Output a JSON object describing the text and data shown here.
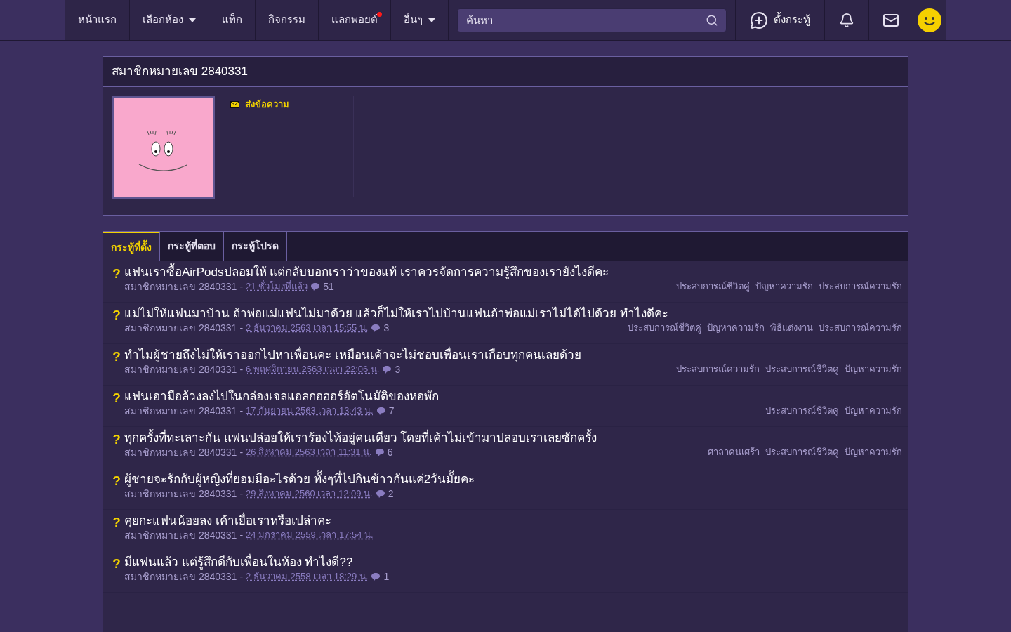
{
  "nav": {
    "items": [
      {
        "label": "หน้าแรก",
        "dropdown": false,
        "notification": false
      },
      {
        "label": "เลือกห้อง",
        "dropdown": true,
        "notification": false
      },
      {
        "label": "แท็ก",
        "dropdown": false,
        "notification": false
      },
      {
        "label": "กิจกรรม",
        "dropdown": false,
        "notification": false
      },
      {
        "label": "แลกพอยต์",
        "dropdown": false,
        "notification": true
      },
      {
        "label": "อื่นๆ",
        "dropdown": true,
        "notification": false
      }
    ],
    "search": {
      "placeholder": "ค้นหา"
    },
    "new_topic": "ตั้งกระทู้"
  },
  "profile": {
    "title": "สมาชิกหมายเลข 2840331",
    "send_message": "ส่งข้อความ"
  },
  "tabs": [
    {
      "label": "กระทู้ที่ตั้ง",
      "selected": true
    },
    {
      "label": "กระทู้ที่ตอบ",
      "selected": false
    },
    {
      "label": "กระทู้โปรด",
      "selected": false
    }
  ],
  "status_mark": "?",
  "separator": "-",
  "posts": [
    {
      "title": "แฟนเราซื้อAirPodsปลอมให้ แต่กลับบอกเราว่าของแท้ เราควรจัดการความรู้สึกของเรายังไงดีคะ",
      "author": "สมาชิกหมายเลข 2840331",
      "time": "21 ชั่วโมงที่แล้ว",
      "comments": "51",
      "tags": [
        "ประสบการณ์ชีวิตคู่",
        "ปัญหาความรัก",
        "ประสบการณ์ความรัก"
      ]
    },
    {
      "title": "แม่ไม่ให้แฟนมาบ้าน ถ้าพ่อแม่แฟนไม่มาด้วย แล้วก็ไม่ให้เราไปบ้านแฟนถ้าพ่อแม่เราไม่ได้ไปด้วย ทำไงดีคะ",
      "author": "สมาชิกหมายเลข 2840331",
      "time": "2 ธันวาคม 2563 เวลา 15:55 น.",
      "comments": "3",
      "tags": [
        "ประสบการณ์ชีวิตคู่",
        "ปัญหาความรัก",
        "พิธีแต่งงาน",
        "ประสบการณ์ความรัก"
      ]
    },
    {
      "title": "ทำไมผู้ชายถึงไม่ให้เราออกไปหาเพื่อนคะ เหมือนเค้าจะไม่ชอบเพื่อนเราเกือบทุกคนเลยด้วย",
      "author": "สมาชิกหมายเลข 2840331",
      "time": "6 พฤศจิกายน 2563 เวลา 22:06 น.",
      "comments": "3",
      "tags": [
        "ประสบการณ์ความรัก",
        "ประสบการณ์ชีวิตคู่",
        "ปัญหาความรัก"
      ]
    },
    {
      "title": "แฟนเอามือล้วงลงไปในกล่องเจลแอลกอฮอร์อัตโนมัติของหอพัก",
      "author": "สมาชิกหมายเลข 2840331",
      "time": "17 กันยายน 2563 เวลา 13:43 น.",
      "comments": "7",
      "tags": [
        "ประสบการณ์ชีวิตคู่",
        "ปัญหาความรัก"
      ]
    },
    {
      "title": "ทุกครั้งที่ทะเลาะกัน แฟนปล่อยให้เราร้องไห้อยู่คนเดียว โดยที่เค้าไม่เข้ามาปลอบเราเลยซักครั้ง",
      "author": "สมาชิกหมายเลข 2840331",
      "time": "26 สิงหาคม 2563 เวลา 11:31 น.",
      "comments": "6",
      "tags": [
        "ศาลาคนเศร้า",
        "ประสบการณ์ชีวิตคู่",
        "ปัญหาความรัก"
      ]
    },
    {
      "title": "ผู้ชายจะรักกับผู้หญิงที่ยอมมีอะไรด้วย ทั้งๆที่ไปกินข้าวกันแค่2วันมั้ยคะ",
      "author": "สมาชิกหมายเลข 2840331",
      "time": "29 สิงหาคม 2560 เวลา 12:09 น.",
      "comments": "2"
    },
    {
      "title": "คุยกะแฟนน้อยลง เค้าเยื่อเราหรือเปล่าคะ",
      "author": "สมาชิกหมายเลข 2840331",
      "time": "24 มกราคม 2559 เวลา 17:54 น."
    },
    {
      "title": "มีแฟนแล้ว แต่รู้สึกดีกับเพื่อนในห้อง ทำไงดี??",
      "author": "สมาชิกหมายเลข 2840331",
      "time": "2 ธันวาคม 2558 เวลา 18:29 น.",
      "comments": "1"
    }
  ]
}
